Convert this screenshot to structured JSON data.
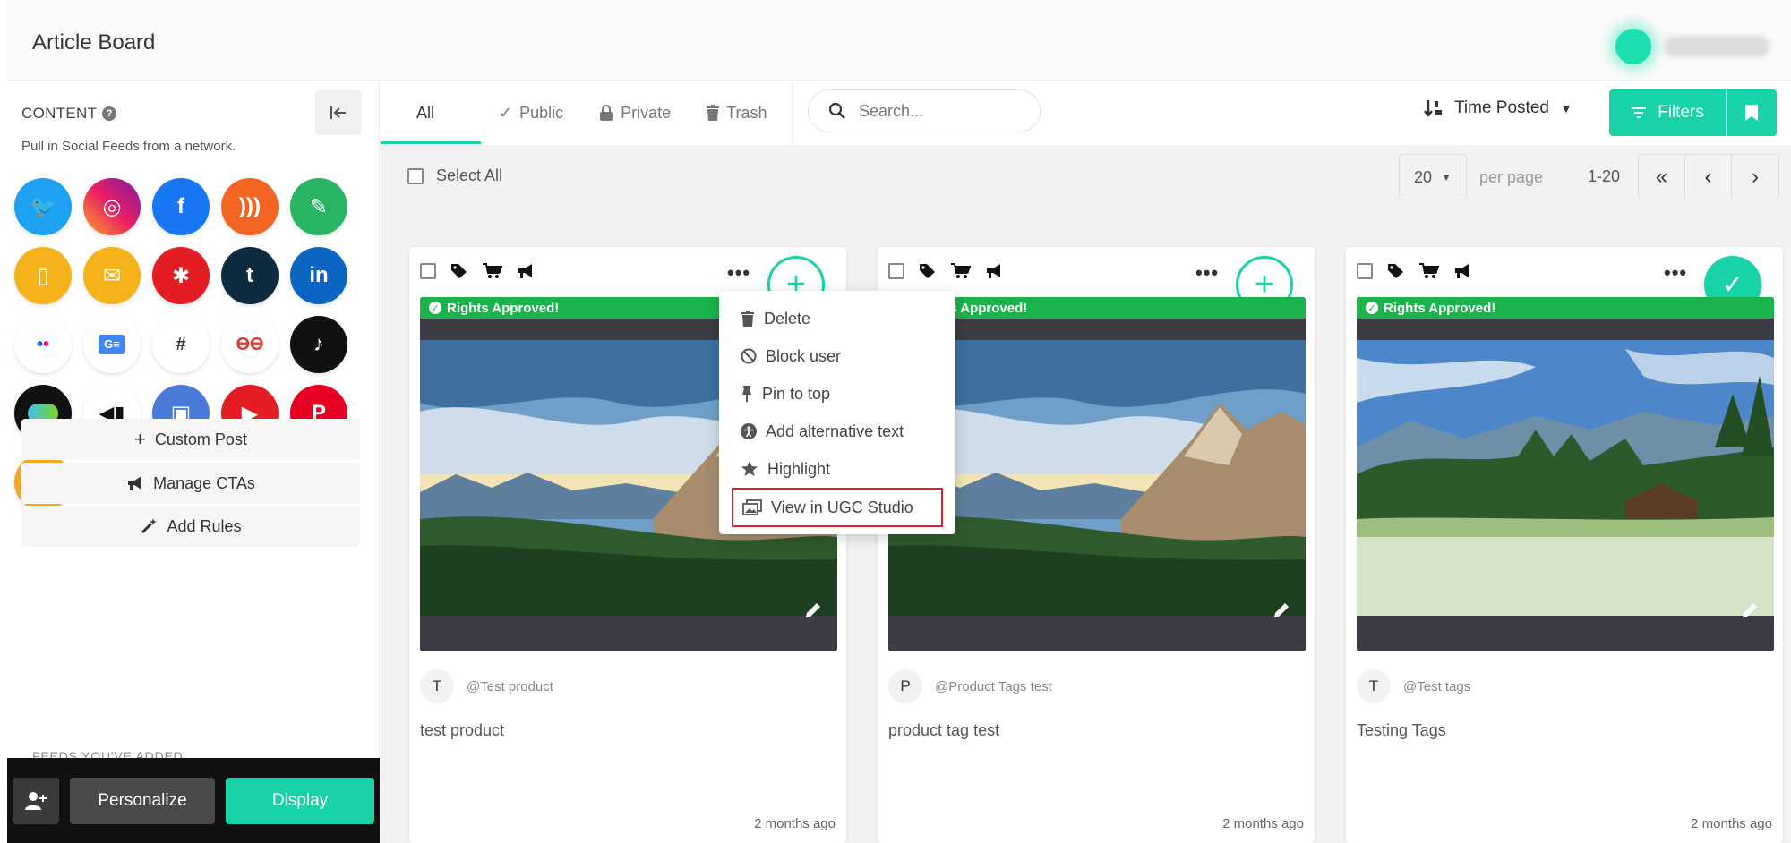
{
  "header": {
    "title": "Article Board"
  },
  "sidebar": {
    "heading": "CONTENT",
    "subtitle": "Pull in Social Feeds from a network.",
    "networks": [
      {
        "name": "twitter",
        "color": "#1da1f2",
        "glyph": "🐦"
      },
      {
        "name": "instagram",
        "color": "#d6249f",
        "glyph": "◎"
      },
      {
        "name": "facebook",
        "color": "#1877f2",
        "glyph": "f"
      },
      {
        "name": "rss",
        "color": "#f26522",
        "glyph": ")))"
      },
      {
        "name": "custom-pencil",
        "color": "#28b463",
        "glyph": "✎"
      },
      {
        "name": "mobile",
        "color": "#f5b21b",
        "glyph": "▯"
      },
      {
        "name": "email",
        "color": "#f5b21b",
        "glyph": "✉"
      },
      {
        "name": "yelp",
        "color": "#e41d24",
        "glyph": "✱"
      },
      {
        "name": "tumblr",
        "color": "#0f2b40",
        "glyph": "t"
      },
      {
        "name": "linkedin",
        "color": "#0a66c2",
        "glyph": "in"
      },
      {
        "name": "flickr",
        "color": "#ffffff",
        "glyph": "••"
      },
      {
        "name": "google-news",
        "color": "#ffffff",
        "glyph": "G"
      },
      {
        "name": "slack",
        "color": "#ffffff",
        "glyph": "#"
      },
      {
        "name": "hootsuite",
        "color": "#ffffff",
        "glyph": "ϴ"
      },
      {
        "name": "tiktok",
        "color": "#111111",
        "glyph": "♪"
      },
      {
        "name": "webex",
        "color": "#111111",
        "glyph": "w"
      },
      {
        "name": "megaphone",
        "color": "#ffffff",
        "glyph": "📢"
      },
      {
        "name": "teams",
        "color": "#4a7bd8",
        "glyph": "▣"
      },
      {
        "name": "youtube",
        "color": "#e41d24",
        "glyph": "▶"
      },
      {
        "name": "pinterest",
        "color": "#e60023",
        "glyph": "P"
      },
      {
        "name": "reviews-star",
        "color": "#f5a623",
        "glyph": "★"
      }
    ],
    "custom_post": "Custom Post",
    "manage_ctas": "Manage CTAs",
    "add_rules": "Add Rules",
    "feeds_added": "FEEDS YOU'VE ADDED",
    "personalize": "Personalize",
    "display": "Display"
  },
  "toolbar": {
    "tabs": [
      "All",
      "Public",
      "Private",
      "Trash"
    ],
    "search_placeholder": "Search...",
    "sort_label": "Time Posted",
    "filters_label": "Filters"
  },
  "subbar": {
    "select_all": "Select All",
    "per_page_value": "20",
    "per_page_label": "per page",
    "range": "1-20"
  },
  "cards": [
    {
      "rights": "Rights Approved!",
      "author_initial": "T",
      "handle": "@Test product",
      "caption": "test product",
      "time": "2 months ago",
      "state": "add"
    },
    {
      "rights": "Rights Approved!",
      "author_initial": "P",
      "handle": "@Product Tags test",
      "caption": "product tag test",
      "time": "2 months ago",
      "state": "add"
    },
    {
      "rights": "Rights Approved!",
      "author_initial": "T",
      "handle": "@Test tags",
      "caption": "Testing Tags",
      "time": "2 months ago",
      "state": "approved"
    }
  ],
  "context_menu": {
    "items": [
      "Delete",
      "Block user",
      "Pin to top",
      "Add alternative text",
      "Highlight",
      "View in UGC Studio"
    ]
  },
  "colors": {
    "accent": "#17d3a7",
    "rights_green": "#19b44b",
    "highlight_border": "#e02020"
  }
}
